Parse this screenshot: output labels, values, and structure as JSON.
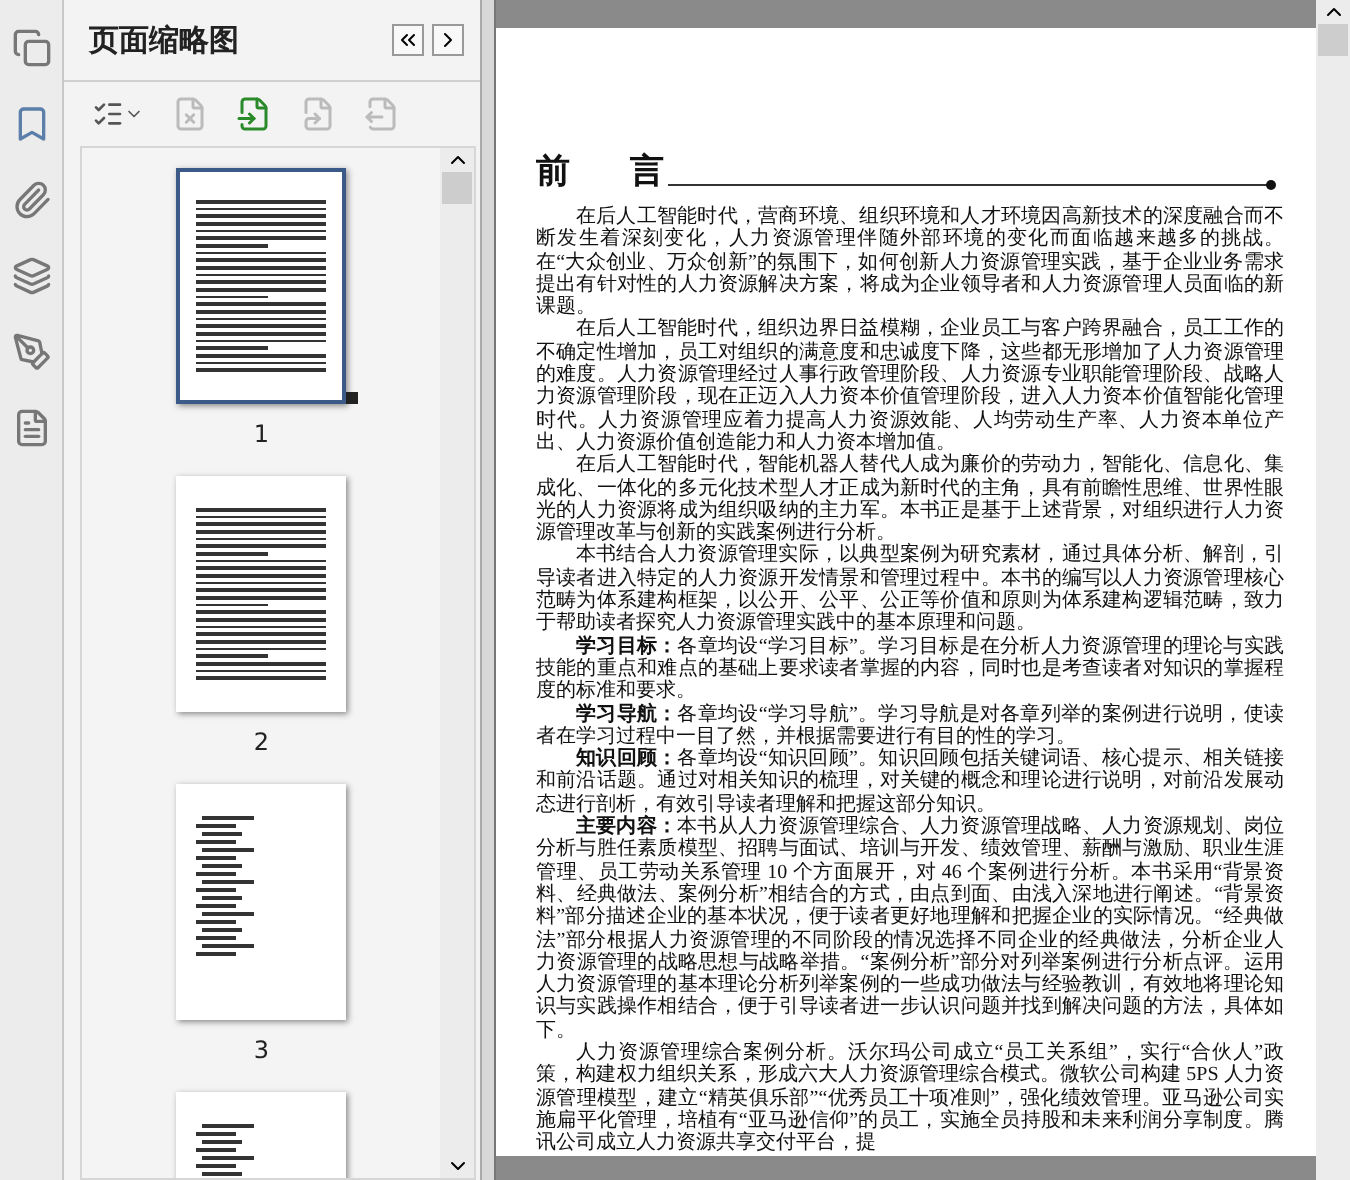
{
  "panel": {
    "title": "页面缩略图"
  },
  "toolbar": [
    {
      "kind": "options",
      "disabled": false
    },
    {
      "kind": "delete",
      "disabled": true
    },
    {
      "kind": "insert",
      "disabled": false
    },
    {
      "kind": "undo",
      "disabled": true
    },
    {
      "kind": "redo",
      "disabled": true
    }
  ],
  "thumbnails": [
    {
      "label": "1",
      "selected": true,
      "kind": "text"
    },
    {
      "label": "2",
      "selected": false,
      "kind": "text"
    },
    {
      "label": "3",
      "selected": false,
      "kind": "contents"
    },
    {
      "selected": false,
      "kind": "contents"
    }
  ],
  "document": {
    "heading": [
      "前",
      "言"
    ],
    "paragraphs": [
      "在后人工智能时代，营商环境、组织环境和人才环境因高新技术的深度融合而不断发生着深刻变化，人力资源管理伴随外部环境的变化而面临越来越多的挑战。在“大众创业、万众创新”的氛围下，如何创新人力资源管理实践，基于企业业务需求提出有针对性的人力资源解决方案，将成为企业领导者和人力资源管理人员面临的新课题。",
      "在后人工智能时代，组织边界日益模糊，企业员工与客户跨界融合，员工工作的不确定性增加，员工对组织的满意度和忠诚度下降，这些都无形增加了人力资源管理的难度。人力资源管理经过人事行政管理阶段、人力资源专业职能管理阶段、战略人力资源管理阶段，现在正迈入人力资本价值管理阶段，进入人力资本价值智能化管理时代。人力资源管理应着力提高人力资源效能、人均劳动生产率、人力资本单位产出、人力资源价值创造能力和人力资本增加值。",
      "在后人工智能时代，智能机器人替代人成为廉价的劳动力，智能化、信息化、集成化、一体化的多元化技术型人才正成为新时代的主角，具有前瞻性思维、世界性眼光的人力资源将成为组织吸纳的主力军。本书正是基于上述背景，对组织进行人力资源管理改革与创新的实践案例进行分析。",
      "本书结合人力资源管理实际，以典型案例为研究素材，通过具体分析、解剖，引导读者进入特定的人力资源开发情景和管理过程中。本书的编写以人力资源管理核心范畴为体系建构框架，以公开、公平、公正等价值和原则为体系建构逻辑范畴，致力于帮助读者探究人力资源管理实践中的基本原理和问题。",
      "**学习目标：**各章均设“学习目标”。学习目标是在分析人力资源管理的理论与实践技能的重点和难点的基础上要求读者掌握的内容，同时也是考查读者对知识的掌握程度的标准和要求。",
      "**学习导航：**各章均设“学习导航”。学习导航是对各章列举的案例进行说明，使读者在学习过程中一目了然，并根据需要进行有目的性的学习。",
      "**知识回顾：**各章均设“知识回顾”。知识回顾包括关键词语、核心提示、相关链接和前沿话题。通过对相关知识的梳理，对关键的概念和理论进行说明，对前沿发展动态进行剖析，有效引导读者理解和把握这部分知识。",
      "**主要内容：**本书从人力资源管理综合、人力资源管理战略、人力资源规划、岗位分析与胜任素质模型、招聘与面试、培训与开发、绩效管理、薪酬与激励、职业生涯管理、员工劳动关系管理 10 个方面展开，对 46 个案例进行分析。本书采用“背景资料、经典做法、案例分析”相结合的方式，由点到面、由浅入深地进行阐述。“背景资料”部分描述企业的基本状况，便于读者更好地理解和把握企业的实际情况。“经典做法”部分根据人力资源管理的不同阶段的情况选择不同企业的经典做法，分析企业人力资源管理的战略思想与战略举措。“案例分析”部分对列举案例进行分析点评。运用人力资源管理的基本理论分析列举案例的一些成功做法与经验教训，有效地将理论知识与实践操作相结合，便于引导读者进一步认识问题并找到解决问题的方法，具体如下。",
      "人力资源管理综合案例分析。沃尔玛公司成立“员工关系组”，实行“合伙人”政策，构建权力组织关系，形成六大人力资源管理综合模式。微软公司构建 5PS 人力资源管理模型，建立“精英俱乐部”“优秀员工十项准则”，强化绩效管理。亚马逊公司实施扁平化管理，培植有“亚马逊信仰”的员工，实施全员持股和未来利润分享制度。腾讯公司成立人力资源共享交付平台，提"
    ]
  }
}
